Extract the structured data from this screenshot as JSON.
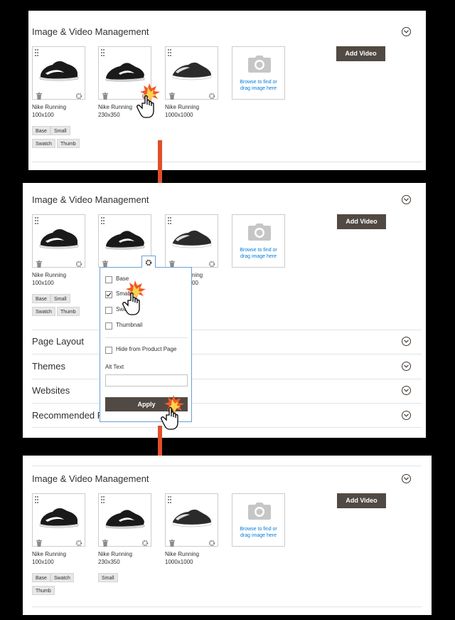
{
  "section_title": "Image & Video Management",
  "add_video_label": "Add Video",
  "upload_text": [
    "Browse to find or",
    "drag image here"
  ],
  "images": [
    {
      "name": "Nike Running",
      "size": "100x100"
    },
    {
      "name": "Nike Running",
      "size": "230x350"
    },
    {
      "name": "Nike Running",
      "size": "1000x1000"
    }
  ],
  "panel1": {
    "tags_image1": [
      "Base",
      "Small",
      "Swatch",
      "Thumb"
    ]
  },
  "panel2": {
    "tags_image1": [
      "Base",
      "Small",
      "Swatch",
      "Thumb"
    ],
    "popup": {
      "roles": [
        {
          "label": "Base",
          "checked": false
        },
        {
          "label": "Small",
          "checked": true
        },
        {
          "label": "Swatch",
          "checked": false
        },
        {
          "label": "Thumbnail",
          "checked": false
        }
      ],
      "hide_label": "Hide from Product Page",
      "alt_label": "Alt Text",
      "alt_value": "",
      "apply_label": "Apply"
    },
    "other_sections": [
      "Page Layout",
      "Themes",
      "Websites",
      "Recommended Products"
    ]
  },
  "panel3": {
    "tags_image1": [
      "Base",
      "Swatch",
      "Thumb"
    ],
    "tags_image2": [
      "Small"
    ]
  },
  "colors": {
    "accent_arrow": "#e04e2b",
    "button": "#514943",
    "link": "#007bdb"
  }
}
